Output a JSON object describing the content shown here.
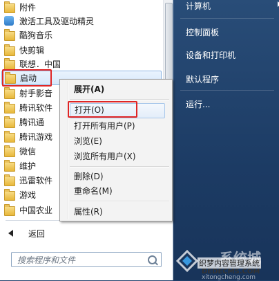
{
  "programs": [
    {
      "label": "附件",
      "icon": "folder-icon"
    },
    {
      "label": "激活工具及驱动精灵",
      "icon": "tool-app-icon",
      "color": "#3a8ad6"
    },
    {
      "label": "酷狗音乐",
      "icon": "folder-icon"
    },
    {
      "label": "快剪辑",
      "icon": "folder-icon"
    },
    {
      "label": "联想．中国",
      "icon": "folder-icon"
    },
    {
      "label": "启动",
      "icon": "folder-icon",
      "selected": true
    },
    {
      "label": "射手影音",
      "icon": "folder-icon"
    },
    {
      "label": "腾讯软件",
      "icon": "folder-icon"
    },
    {
      "label": "腾讯通",
      "icon": "folder-icon"
    },
    {
      "label": "腾讯游戏",
      "icon": "folder-icon"
    },
    {
      "label": "微信",
      "icon": "folder-icon"
    },
    {
      "label": "维护",
      "icon": "folder-icon"
    },
    {
      "label": "迅雷软件",
      "icon": "folder-icon"
    },
    {
      "label": "游戏",
      "icon": "folder-icon"
    },
    {
      "label": "中国农业",
      "icon": "folder-icon"
    }
  ],
  "back_label": "返回",
  "search": {
    "placeholder": "搜索程序和文件"
  },
  "right_menu": [
    {
      "label": "计算机",
      "has_arrow": true
    },
    {
      "label": "控制面板"
    },
    {
      "label": "设备和打印机"
    },
    {
      "label": "默认程序"
    },
    {
      "label": "运行..."
    }
  ],
  "context_menu": [
    {
      "label": "展开(A)",
      "bold": true
    },
    {
      "label": "打开(O)",
      "highlighted": true
    },
    {
      "label": "打开所有用户(P)"
    },
    {
      "label": "浏览(E)"
    },
    {
      "label": "浏览所有用户(X)"
    },
    {
      "label": "删除(D)"
    },
    {
      "label": "重命名(M)"
    },
    {
      "label": "属性(R)"
    }
  ],
  "watermark": {
    "name": "系统城",
    "text": "织梦内容管理系统",
    "url": "DEDECMS.COM",
    "url2": "xitongcheng.com"
  },
  "colors": {
    "highlight_box": "#e02525",
    "right_pane": "#294d78",
    "selection": "#d6e8fb"
  }
}
